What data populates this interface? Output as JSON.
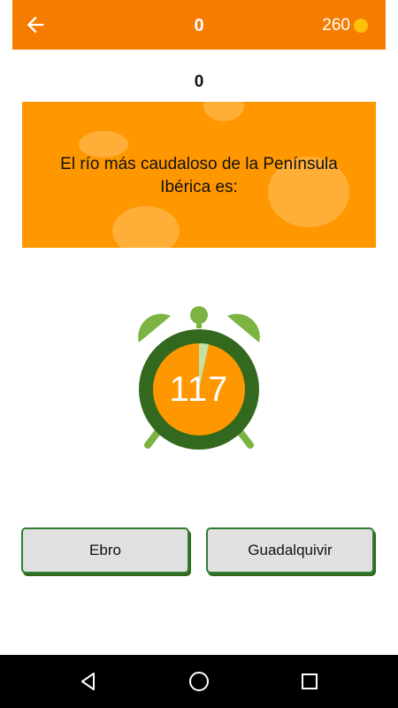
{
  "header": {
    "score": "0",
    "coins": "260",
    "back_icon": "arrow-left-icon",
    "coin_icon": "coin-icon"
  },
  "round": "0",
  "question": {
    "text": "El río más caudaloso de la Península Ibérica es:"
  },
  "timer": {
    "value": "117",
    "icon": "alarm-clock-icon"
  },
  "answers": [
    {
      "label": "Ebro"
    },
    {
      "label": "Guadalquivir"
    }
  ],
  "nav": {
    "back_icon": "nav-back-icon",
    "home_icon": "nav-home-icon",
    "recents_icon": "nav-recents-icon"
  },
  "colors": {
    "app_bar": "#f57c00",
    "card": "#ff9800",
    "timer_ring": "#33691e",
    "timer_bells": "#7cb342",
    "button_border": "#2e7d32",
    "coin": "#ffc107"
  }
}
